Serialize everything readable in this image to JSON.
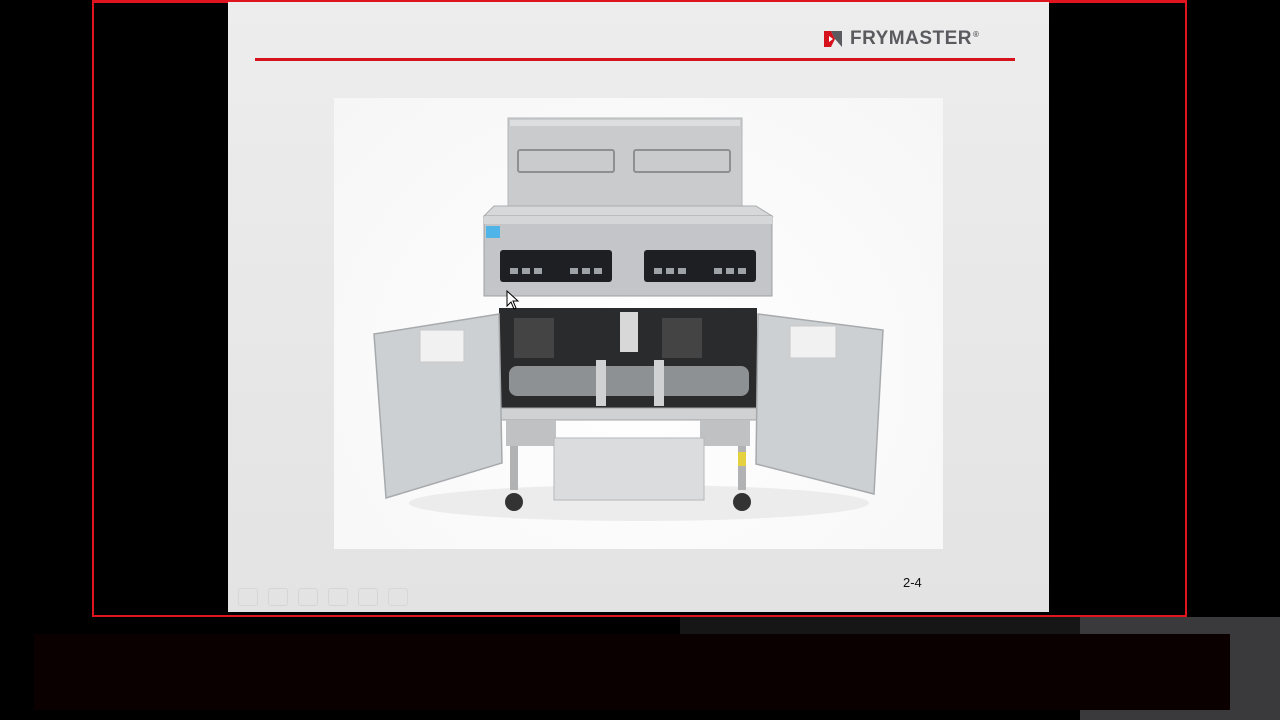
{
  "slide": {
    "brand": "FRYMASTER",
    "brand_mark": "®",
    "page_number": "2-4"
  },
  "colors": {
    "frame_red": "#e0141e",
    "rule_red": "#d6121d",
    "logo_grey": "#5a5a5f"
  },
  "icons": {
    "logo_mark": "frymaster-logo-icon",
    "cursor": "mouse-pointer-icon"
  }
}
